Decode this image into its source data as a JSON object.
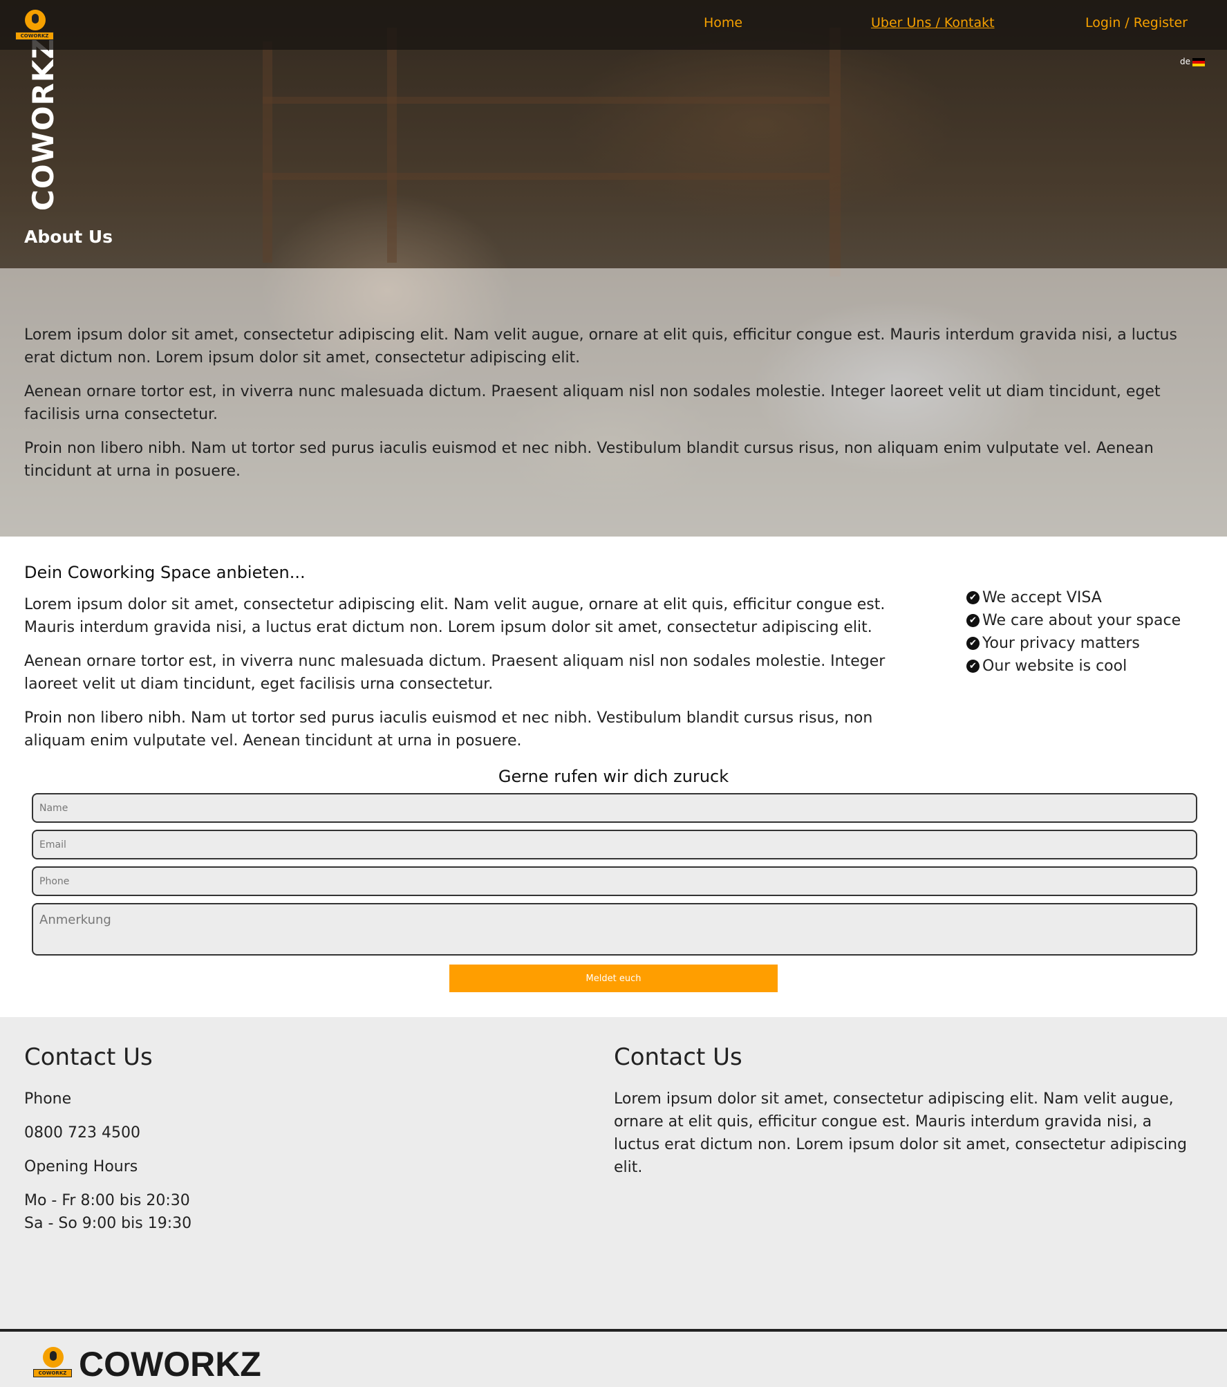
{
  "nav": {
    "logo_text": "COWORKZ",
    "home": "Home",
    "about": "Uber Uns / Kontakt",
    "login": "Login / Register",
    "lang": "de"
  },
  "hero": {
    "brand": "COWORKZ",
    "title": "About Us",
    "paragraphs": [
      "Lorem ipsum dolor sit amet, consectetur adipiscing elit. Nam velit augue, ornare at elit quis, efficitur congue est. Mauris interdum gravida nisi, a luctus erat dictum non. Lorem ipsum dolor sit amet, consectetur adipiscing elit.",
      "Aenean ornare tortor est, in viverra nunc malesuada dictum. Praesent aliquam nisl non sodales molestie. Integer laoreet velit ut diam tincidunt, eget facilisis urna consectetur.",
      "Proin non libero nibh. Nam ut tortor sed purus iaculis euismod et nec nibh. Vestibulum blandit cursus risus, non aliquam enim vulputate vel. Aenean tincidunt at urna in posuere."
    ]
  },
  "offer": {
    "heading": "Dein Coworking Space anbieten...",
    "paragraphs": [
      "Lorem ipsum dolor sit amet, consectetur adipiscing elit. Nam velit augue, ornare at elit quis, efficitur congue est. Mauris interdum gravida nisi, a luctus erat dictum non. Lorem ipsum dolor sit amet, consectetur adipiscing elit.",
      "Aenean ornare tortor est, in viverra nunc malesuada dictum. Praesent aliquam nisl non sodales molestie. Integer laoreet velit ut diam tincidunt, eget facilisis urna consectetur.",
      "Proin non libero nibh. Nam ut tortor sed purus iaculis euismod et nec nibh. Vestibulum blandit cursus risus, non aliquam enim vulputate vel. Aenean tincidunt at urna in posuere."
    ],
    "checks": [
      "We accept VISA",
      "We care about your space",
      "Your privacy matters",
      "Our website is cool"
    ]
  },
  "form": {
    "title": "Gerne rufen wir dich zuruck",
    "name_placeholder": "Name",
    "email_placeholder": "Email",
    "phone_placeholder": "Phone",
    "note_placeholder": "Anmerkung",
    "submit": "Meldet euch"
  },
  "footer": {
    "left": {
      "title": "Contact Us",
      "phone_label": "Phone",
      "phone": "0800 723 4500",
      "hours_label": "Opening Hours",
      "hours_weekday": "Mo - Fr 8:00 bis 20:30",
      "hours_weekend": "Sa - So 9:00 bis 19:30"
    },
    "right": {
      "title": "Contact Us",
      "text": "Lorem ipsum dolor sit amet, consectetur adipiscing elit. Nam velit augue, ornare at elit quis, efficitur congue est. Mauris interdum gravida nisi, a luctus erat dictum non. Lorem ipsum dolor sit amet, consectetur adipiscing elit."
    },
    "brand": "COWORKZ"
  },
  "colors": {
    "accent": "#ff9e00",
    "footer_bg": "#ececec"
  }
}
